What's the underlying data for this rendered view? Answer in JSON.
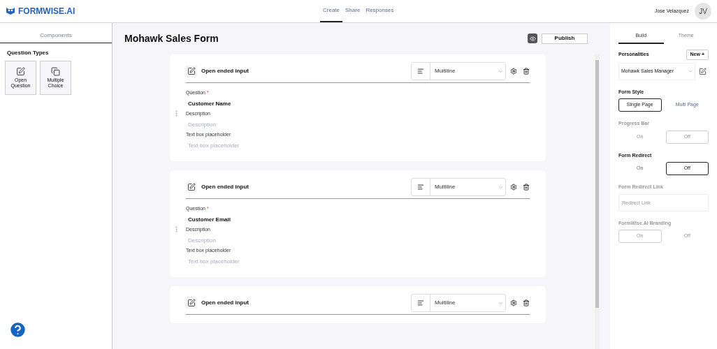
{
  "header": {
    "logo": "FORMWISE.AI",
    "tabs": [
      {
        "label": "Create",
        "selected": true
      },
      {
        "label": "Share",
        "selected": false
      },
      {
        "label": "Responses",
        "selected": false
      }
    ],
    "user_name": "Jose Velazquez",
    "avatar": "JV"
  },
  "sidebar": {
    "tabs": [
      {
        "label": "Components",
        "selected": true
      }
    ],
    "section_title": "Question Types",
    "items": [
      {
        "label": "Open Question",
        "kind": "open"
      },
      {
        "label": "Multiple Choice",
        "kind": "multiple"
      }
    ]
  },
  "form": {
    "title": "Mohawk Sales Form",
    "publish": "Publish",
    "cards": [
      {
        "type_label": "Open ended input",
        "format": "Multiline",
        "fields": [
          {
            "label": "Question",
            "required_mark": "*",
            "value": "Customer Name"
          },
          {
            "label": "Description",
            "placeholder": "Description"
          },
          {
            "label": "Text box placeholder",
            "placeholder": "Text box placeholder"
          }
        ]
      },
      {
        "type_label": "Open ended input",
        "format": "Multiline",
        "fields": [
          {
            "label": "Question",
            "required_mark": "*",
            "value": "Customer Email"
          },
          {
            "label": "Description",
            "placeholder": "Description"
          },
          {
            "label": "Text box placeholder",
            "placeholder": "Text box placeholder"
          }
        ]
      },
      {
        "type_label": "Open ended input",
        "format": "Multiline"
      }
    ]
  },
  "panel": {
    "tabs": [
      {
        "label": "Build",
        "selected": true
      },
      {
        "label": "Theme",
        "selected": false
      }
    ],
    "personalities": {
      "title": "Personalities",
      "new_button": "New +",
      "value": "Mohawk Sales Manager"
    },
    "groups": [
      {
        "kind": "toggle",
        "title": "Form Style",
        "disabled": false,
        "options": [
          {
            "label": "Single Page",
            "selected": true
          },
          {
            "label": "Multi Page",
            "selected": false
          }
        ]
      },
      {
        "kind": "toggle",
        "title": "Progress Bar",
        "disabled": true,
        "options": [
          {
            "label": "On",
            "selected": false
          },
          {
            "label": "Off",
            "selected": true
          }
        ]
      },
      {
        "kind": "toggle",
        "title": "Form Redirect",
        "disabled": false,
        "options": [
          {
            "label": "On",
            "selected": false
          },
          {
            "label": "Off",
            "selected": true
          }
        ]
      },
      {
        "kind": "input",
        "title": "Form Redirect Link",
        "disabled": true,
        "placeholder": "Redirect Link"
      },
      {
        "kind": "toggle",
        "title": "FormWise.AI Branding",
        "disabled": true,
        "options": [
          {
            "label": "On",
            "selected": true
          },
          {
            "label": "Off",
            "selected": false
          }
        ]
      }
    ]
  }
}
